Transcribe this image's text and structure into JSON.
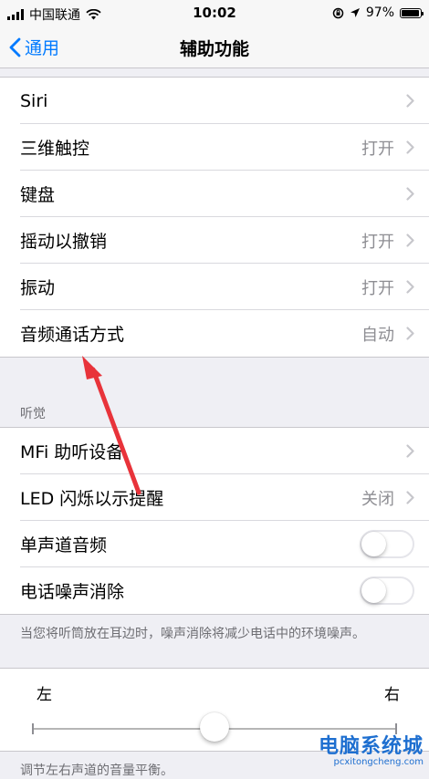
{
  "status_bar": {
    "carrier": "中国联通",
    "time": "10:02",
    "battery": "97%",
    "battery_level": 0.97
  },
  "nav": {
    "back_label": "通用",
    "title": "辅助功能"
  },
  "group1": {
    "rows": [
      {
        "label": "Siri",
        "value": ""
      },
      {
        "label": "三维触控",
        "value": "打开"
      },
      {
        "label": "键盘",
        "value": ""
      },
      {
        "label": "摇动以撤销",
        "value": "打开"
      },
      {
        "label": "振动",
        "value": "打开"
      },
      {
        "label": "音频通话方式",
        "value": "自动"
      }
    ]
  },
  "hearing": {
    "header": "听觉",
    "rows": [
      {
        "label": "MFi 助听设备",
        "value": ""
      },
      {
        "label": "LED 闪烁以示提醒",
        "value": "关闭"
      },
      {
        "label": "单声道音频",
        "toggle": false
      },
      {
        "label": "电话噪声消除",
        "toggle": false
      }
    ],
    "footnote": "当您将听筒放在耳边时，噪声消除将减少电话中的环境噪声。"
  },
  "balance": {
    "left_label": "左",
    "right_label": "右",
    "value": 0.5,
    "footnote": "调节左右声道的音量平衡。"
  },
  "watermark": {
    "title": "电脑系统城",
    "url": "pcxitongcheng.com"
  },
  "colors": {
    "accent": "#007aff",
    "background": "#efeff4",
    "annotation": "#e8333a"
  }
}
